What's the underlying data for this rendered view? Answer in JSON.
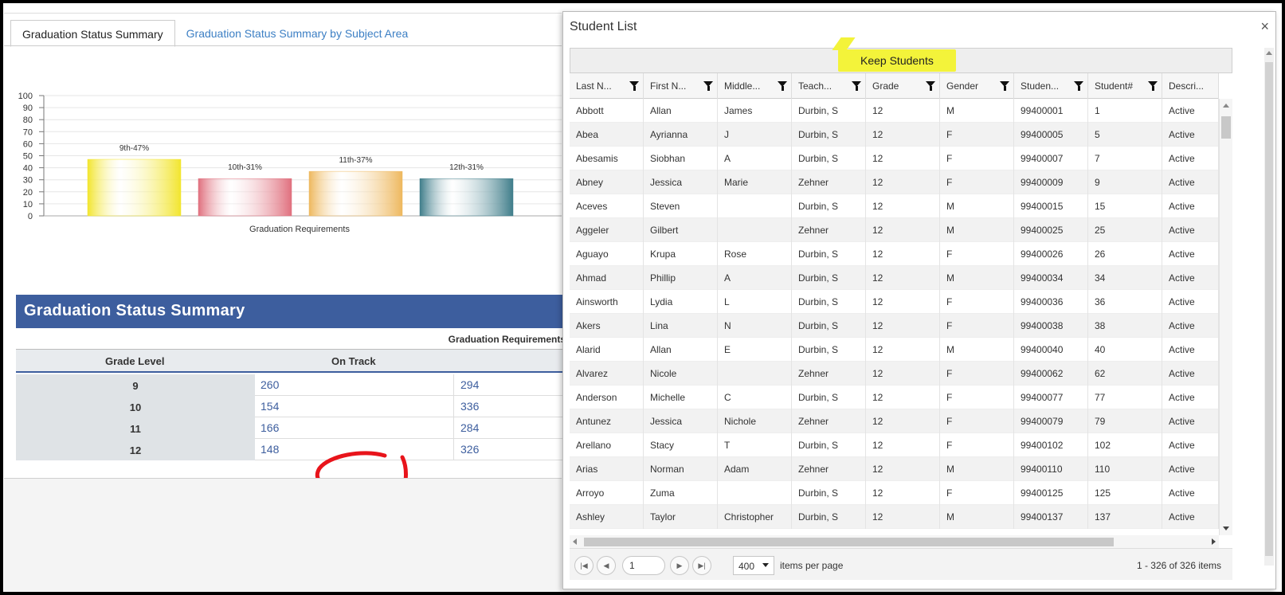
{
  "tabs": [
    {
      "label": "Graduation Status Summary",
      "active": true
    },
    {
      "label": "Graduation Status Summary by Subject Area",
      "active": false
    }
  ],
  "chart_data": {
    "type": "bar",
    "categories": [
      "9th",
      "10th",
      "11th",
      "12th"
    ],
    "values": [
      47,
      31,
      37,
      31
    ],
    "data_labels": [
      "9th-47%",
      "10th-31%",
      "11th-37%",
      "12th-31%"
    ],
    "colors": [
      "#f2e52e",
      "#e0707e",
      "#eeb85e",
      "#3f7d8a"
    ],
    "xlabel": "Graduation Requirements",
    "ylim": [
      0,
      100
    ],
    "yticks": [
      0,
      10,
      20,
      30,
      40,
      50,
      60,
      70,
      80,
      90,
      100
    ],
    "grid": true
  },
  "summary": {
    "title": "Graduation Status Summary",
    "group_header": "Graduation Requirements",
    "columns": [
      "Grade Level",
      "On Track"
    ],
    "rows": [
      {
        "grade": "9",
        "v1": "260",
        "v2": "294"
      },
      {
        "grade": "10",
        "v1": "154",
        "v2": "336"
      },
      {
        "grade": "11",
        "v1": "166",
        "v2": "284"
      },
      {
        "grade": "12",
        "v1": "148",
        "v2": "326"
      }
    ]
  },
  "modal": {
    "title": "Student List",
    "close": "×",
    "keep_button": "Keep Students",
    "columns": [
      "Last N...",
      "First N...",
      "Middle...",
      "Teach...",
      "Grade",
      "Gender",
      "Studen...",
      "Student#",
      "Descri..."
    ],
    "rows": [
      [
        "Abbott",
        "Allan",
        "James",
        "Durbin, S",
        "12",
        "M",
        "99400001",
        "1",
        "Active"
      ],
      [
        "Abea",
        "Ayrianna",
        "J",
        "Durbin, S",
        "12",
        "F",
        "99400005",
        "5",
        "Active"
      ],
      [
        "Abesamis",
        "Siobhan",
        "A",
        "Durbin, S",
        "12",
        "F",
        "99400007",
        "7",
        "Active"
      ],
      [
        "Abney",
        "Jessica",
        "Marie",
        "Zehner",
        "12",
        "F",
        "99400009",
        "9",
        "Active"
      ],
      [
        "Aceves",
        "Steven",
        "",
        "Durbin, S",
        "12",
        "M",
        "99400015",
        "15",
        "Active"
      ],
      [
        "Aggeler",
        "Gilbert",
        "",
        "Zehner",
        "12",
        "M",
        "99400025",
        "25",
        "Active"
      ],
      [
        "Aguayo",
        "Krupa",
        "Rose",
        "Durbin, S",
        "12",
        "F",
        "99400026",
        "26",
        "Active"
      ],
      [
        "Ahmad",
        "Phillip",
        "A",
        "Durbin, S",
        "12",
        "M",
        "99400034",
        "34",
        "Active"
      ],
      [
        "Ainsworth",
        "Lydia",
        "L",
        "Durbin, S",
        "12",
        "F",
        "99400036",
        "36",
        "Active"
      ],
      [
        "Akers",
        "Lina",
        "N",
        "Durbin, S",
        "12",
        "F",
        "99400038",
        "38",
        "Active"
      ],
      [
        "Alarid",
        "Allan",
        "E",
        "Durbin, S",
        "12",
        "M",
        "99400040",
        "40",
        "Active"
      ],
      [
        "Alvarez",
        "Nicole",
        "",
        "Zehner",
        "12",
        "F",
        "99400062",
        "62",
        "Active"
      ],
      [
        "Anderson",
        "Michelle",
        "C",
        "Durbin, S",
        "12",
        "F",
        "99400077",
        "77",
        "Active"
      ],
      [
        "Antunez",
        "Jessica",
        "Nichole",
        "Zehner",
        "12",
        "F",
        "99400079",
        "79",
        "Active"
      ],
      [
        "Arellano",
        "Stacy",
        "T",
        "Durbin, S",
        "12",
        "F",
        "99400102",
        "102",
        "Active"
      ],
      [
        "Arias",
        "Norman",
        "Adam",
        "Zehner",
        "12",
        "M",
        "99400110",
        "110",
        "Active"
      ],
      [
        "Arroyo",
        "Zuma",
        "",
        "Durbin, S",
        "12",
        "F",
        "99400125",
        "125",
        "Active"
      ],
      [
        "Ashley",
        "Taylor",
        "Christopher",
        "Durbin, S",
        "12",
        "M",
        "99400137",
        "137",
        "Active"
      ]
    ],
    "pager": {
      "first": "|◀",
      "prev": "◀",
      "page": "1",
      "next": "▶",
      "last": "▶|",
      "per_page": "400",
      "per_page_label": "items per page",
      "count": "1 - 326 of 326 items"
    }
  }
}
